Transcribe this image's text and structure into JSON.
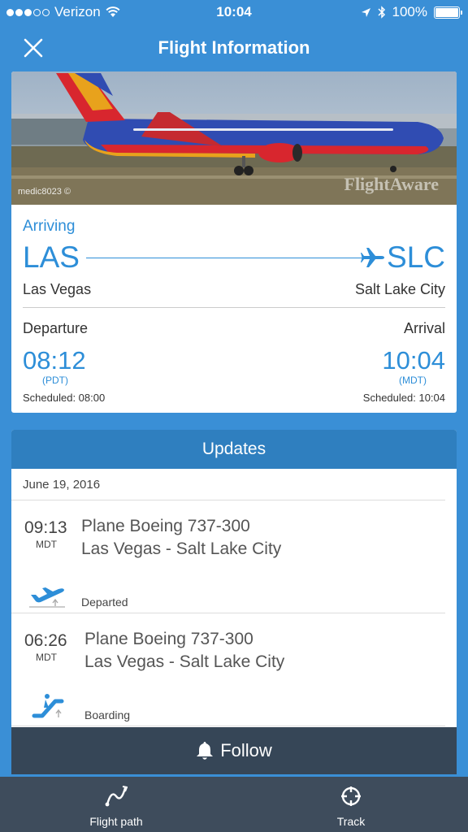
{
  "status_bar": {
    "carrier": "Verizon",
    "time": "10:04",
    "battery": "100%"
  },
  "nav": {
    "title": "Flight Information"
  },
  "photo": {
    "credit": "medic8023 ©",
    "watermark": "FlightAware"
  },
  "flight": {
    "status": "Arriving",
    "origin_code": "LAS",
    "destination_code": "SLC",
    "origin_city": "Las Vegas",
    "destination_city": "Salt Lake City",
    "departure_label": "Departure",
    "arrival_label": "Arrival",
    "departure_time": "08:12",
    "arrival_time": "10:04",
    "departure_tz": "(PDT)",
    "arrival_tz": "(MDT)",
    "departure_scheduled": "Scheduled: 08:00",
    "arrival_scheduled": "Scheduled: 10:04"
  },
  "updates": {
    "header": "Updates",
    "date": "June 19, 2016",
    "items": [
      {
        "time": "09:13",
        "tz": "MDT",
        "line1": "Plane Boeing 737-300",
        "line2": "Las Vegas - Salt Lake City",
        "status": "Departed",
        "icon": "takeoff-icon"
      },
      {
        "time": "06:26",
        "tz": "MDT",
        "line1": "Plane Boeing 737-300",
        "line2": "Las Vegas - Salt Lake City",
        "status": "Boarding",
        "icon": "boarding-icon"
      }
    ]
  },
  "follow_button": {
    "label": "Follow",
    "icon": "bell-icon"
  },
  "tabs": [
    {
      "label": "Flight path",
      "icon": "flight-path-icon"
    },
    {
      "label": "Track",
      "icon": "crosshair-icon"
    }
  ],
  "colors": {
    "accent": "#2d8ed8",
    "header_blue": "#3a8fd6",
    "updates_header": "#2f7fbf",
    "follow_bg": "#364657",
    "tabbar_bg": "#3e4c5c"
  }
}
